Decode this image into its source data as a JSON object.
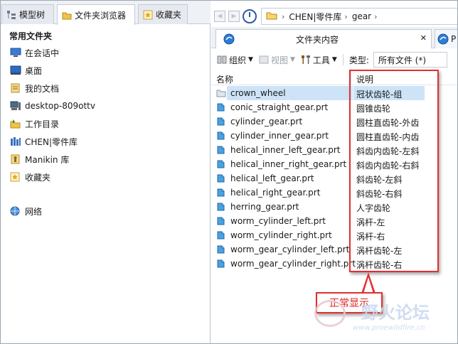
{
  "left_tabs": [
    {
      "label": "模型树",
      "icon": "model-tree-icon"
    },
    {
      "label": "文件夹浏览器",
      "icon": "folder-browser-icon"
    },
    {
      "label": "收藏夹",
      "icon": "favorites-icon"
    }
  ],
  "left_heading": "常用文件夹",
  "nav_items": [
    {
      "label": "在会话中",
      "icon": "monitor-icon"
    },
    {
      "label": "桌面",
      "icon": "desktop-icon"
    },
    {
      "label": "我的文档",
      "icon": "documents-icon"
    },
    {
      "label": "desktop-809ottv",
      "icon": "computer-icon"
    },
    {
      "label": "工作目录",
      "icon": "work-directory-icon"
    },
    {
      "label": "CHEN|零件库",
      "icon": "library-icon"
    },
    {
      "label": "Manikin 库",
      "icon": "manikin-library-icon"
    },
    {
      "label": "收藏夹",
      "icon": "favorites-icon"
    },
    {
      "label": "网络",
      "icon": "network-icon"
    }
  ],
  "breadcrumb": [
    "CHEN|零件库",
    "gear"
  ],
  "content_tabs": [
    {
      "label": "文件夹内容"
    },
    {
      "label": "P"
    }
  ],
  "toolbar": {
    "organize": "组织",
    "views": "视图",
    "tools": "工具",
    "type_label": "类型:",
    "type_value": "所有文件 (*)"
  },
  "columns": {
    "name": "名称",
    "desc": "说明"
  },
  "files": [
    {
      "name": "crown_wheel",
      "desc": "冠状齿轮-组",
      "selected": true,
      "kind": "folder"
    },
    {
      "name": "conic_straight_gear.prt",
      "desc": "圆锥齿轮"
    },
    {
      "name": "cylinder_gear.prt",
      "desc": "圆柱直齿轮-外齿"
    },
    {
      "name": "cylinder_inner_gear.prt",
      "desc": "圆柱直齿轮-内齿"
    },
    {
      "name": "helical_inner_left_gear.prt",
      "desc": "斜齿内齿轮-左斜"
    },
    {
      "name": "helical_inner_right_gear.prt",
      "desc": "斜齿内齿轮-右斜"
    },
    {
      "name": "helical_left_gear.prt",
      "desc": "斜齿轮-左斜"
    },
    {
      "name": "helical_right_gear.prt",
      "desc": "斜齿轮-右斜"
    },
    {
      "name": "herring_gear.prt",
      "desc": "人字齿轮"
    },
    {
      "name": "worm_cylinder_left.prt",
      "desc": "涡杆-左"
    },
    {
      "name": "worm_cylinder_right.prt",
      "desc": "涡杆-右"
    },
    {
      "name": "worm_gear_cylinder_left.prt",
      "desc": "涡杆齿轮-左"
    },
    {
      "name": "worm_gear_cylinder_right.prt",
      "desc": "涡杆齿轮-右"
    }
  ],
  "annotation": "正常显示",
  "watermark": {
    "title": "野火论坛",
    "url": "www.proewildfire.cn"
  },
  "colors": {
    "annotation": "#e03030",
    "selection": "#cde3f7",
    "part_icon": "#4aa3e0"
  }
}
